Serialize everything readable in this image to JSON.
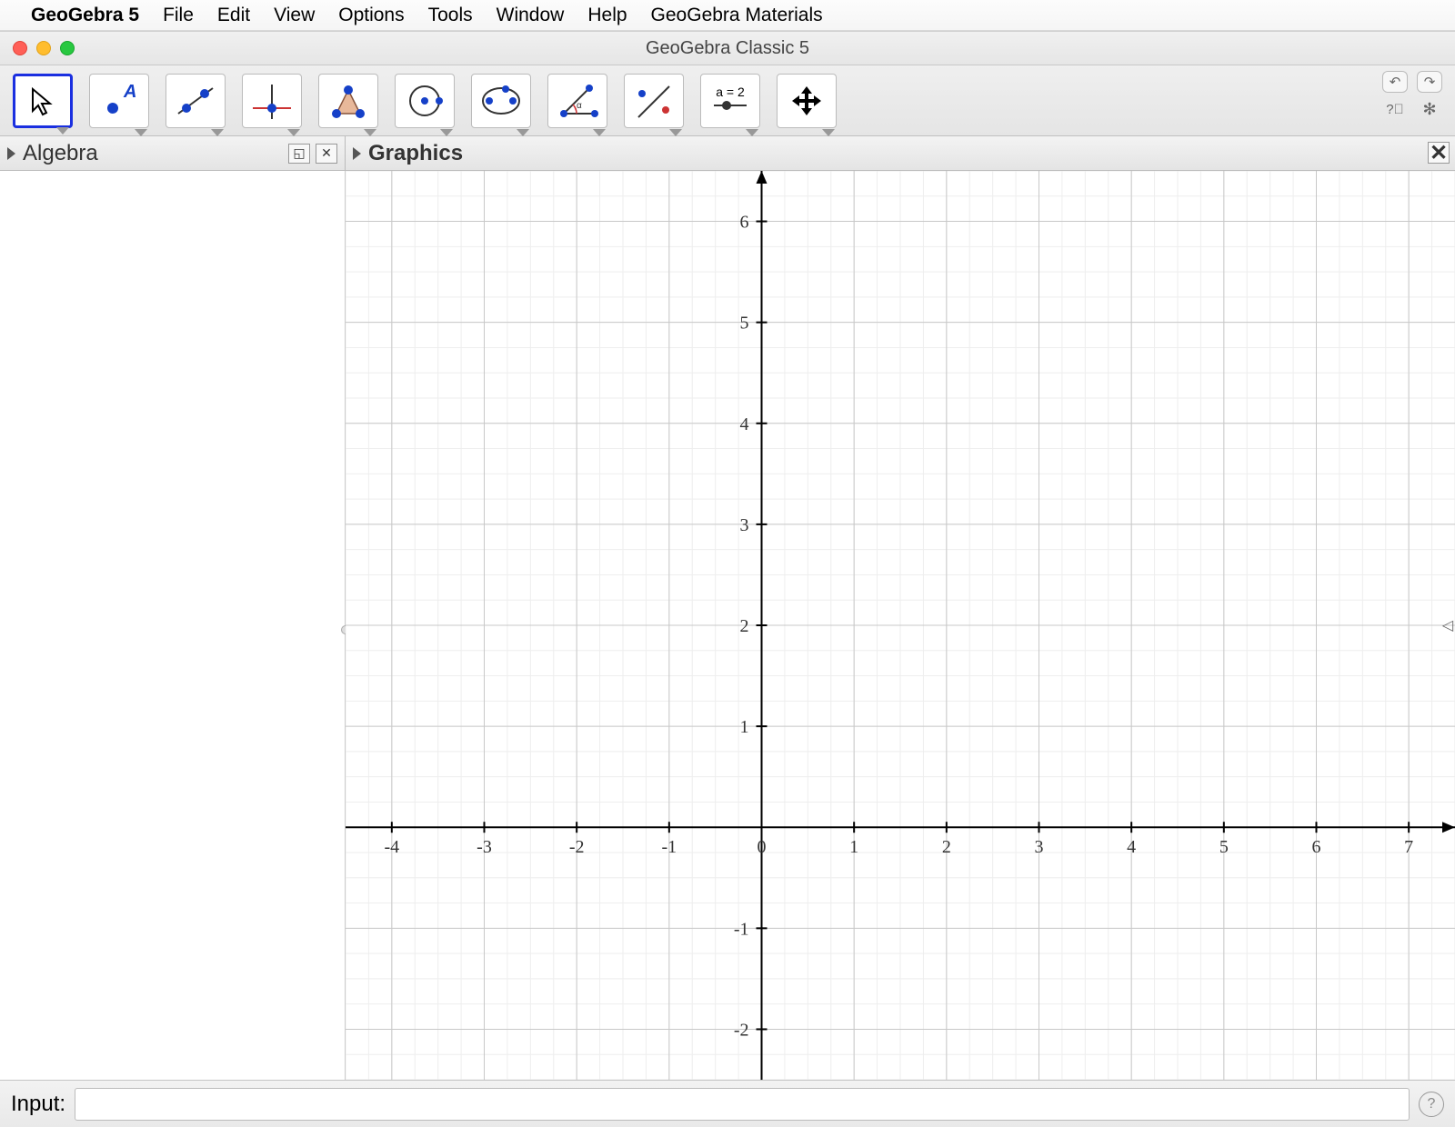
{
  "menubar": {
    "app": "GeoGebra 5",
    "items": [
      "File",
      "Edit",
      "View",
      "Options",
      "Tools",
      "Window",
      "Help",
      "GeoGebra Materials"
    ]
  },
  "window": {
    "title": "GeoGebra Classic 5"
  },
  "toolbar": {
    "tools": [
      "move",
      "point",
      "line",
      "perpendicular",
      "polygon",
      "circle",
      "ellipse",
      "angle",
      "reflect",
      "slider",
      "move-view"
    ],
    "slider_label": "a = 2"
  },
  "views": {
    "algebra": "Algebra",
    "graphics": "Graphics"
  },
  "input": {
    "label": "Input:",
    "value": ""
  },
  "chart_data": {
    "type": "scatter",
    "title": "",
    "xlabel": "",
    "ylabel": "",
    "xlim": [
      -4.5,
      7.5
    ],
    "ylim": [
      -2.5,
      6.5
    ],
    "x_ticks": [
      -4,
      -3,
      -2,
      -1,
      0,
      1,
      2,
      3,
      4,
      5,
      6,
      7
    ],
    "y_ticks": [
      -2,
      -1,
      1,
      2,
      3,
      4,
      5,
      6
    ],
    "series": []
  }
}
